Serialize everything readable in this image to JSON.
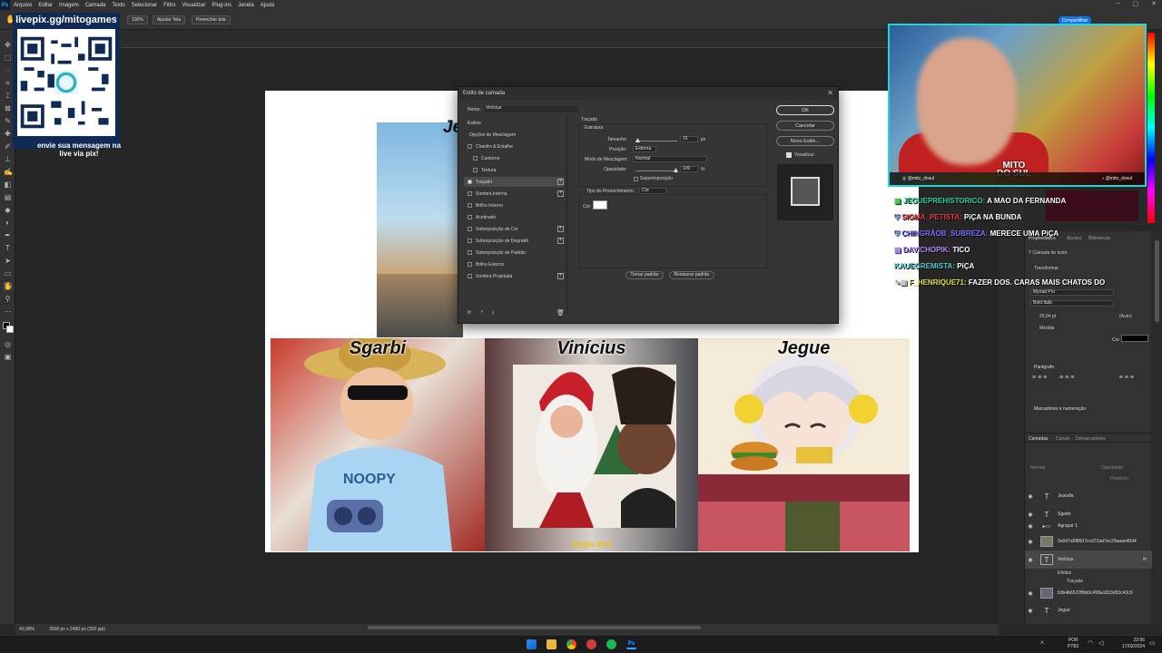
{
  "app": {
    "name": "Ps"
  },
  "menubar": {
    "items": [
      "Arquivo",
      "Editar",
      "Imagem",
      "Camada",
      "Texto",
      "Selecionar",
      "Filtro",
      "Visualizar",
      "Plug-ins",
      "Janela",
      "Ajuda"
    ]
  },
  "options": {
    "zoom_value": "100%",
    "fit_label": "Ajustar Tela",
    "fill_label": "Preencher tela",
    "share_label": "Compartilhar"
  },
  "document": {
    "top_name": "Je",
    "panels": [
      {
        "name": "Sgarbi"
      },
      {
        "name": "Vinícius",
        "caption": "Jingle Bell"
      },
      {
        "name": "Jegue"
      }
    ]
  },
  "dialog": {
    "title": "Estilo de camada",
    "name_label": "Nome:",
    "name_value": "Vinícius",
    "styles_label": "Estilos",
    "blend_options": "Opções de Mesclagem",
    "effects": [
      {
        "label": "Chanfro & Entalhe",
        "checked": false,
        "plus": false
      },
      {
        "label": "Contorno",
        "checked": false,
        "plus": false,
        "indent": true
      },
      {
        "label": "Textura",
        "checked": false,
        "plus": false,
        "indent": true
      },
      {
        "label": "Traçado",
        "checked": true,
        "plus": true
      },
      {
        "label": "Sombra Interna",
        "checked": false,
        "plus": true
      },
      {
        "label": "Brilho Interno",
        "checked": false,
        "plus": false
      },
      {
        "label": "Acetinado",
        "checked": false,
        "plus": false
      },
      {
        "label": "Sobreposição de Cor",
        "checked": false,
        "plus": true
      },
      {
        "label": "Sobreposição de Degradê",
        "checked": false,
        "plus": true
      },
      {
        "label": "Sobreposição de Padrão",
        "checked": false,
        "plus": false
      },
      {
        "label": "Brilho Externo",
        "checked": false,
        "plus": false
      },
      {
        "label": "Sombra Projetada",
        "checked": false,
        "plus": true
      }
    ],
    "section_title": "Traçado",
    "structure_label": "Estrutura",
    "size_label": "Tamanho:",
    "size_value": "16",
    "size_unit": "px",
    "position_label": "Posição:",
    "position_value": "Externa",
    "blend_label": "Modo de Mesclagem:",
    "blend_value": "Normal",
    "opacity_label": "Opacidade:",
    "opacity_value": "100",
    "opacity_unit": "%",
    "overprint_label": "Superimposição",
    "fill_type_label": "Tipo de Preenchimento:",
    "fill_type_value": "Cor",
    "color_label": "Cor:",
    "default_label": "Tornar padrão",
    "reset_label": "Restaurar padrão",
    "ok_label": "OK",
    "cancel_label": "Cancelar",
    "new_style_label": "Novo Estilo...",
    "preview_label": "Visualizar",
    "fx_label": "fx"
  },
  "webcam": {
    "instagram": "@mito_dosul",
    "tiktok": "@mito_dosul",
    "logo_line1": "MITO",
    "logo_line2": "DO SUL"
  },
  "chat": [
    {
      "user": "JEGUEPREHISTORICO:",
      "msg": "A MAO DA FERNANDA",
      "color": "#1fd4a0"
    },
    {
      "user": "SIGMA_PETISTA:",
      "msg": "PiÇA NA BUNDA",
      "color": "#e63b3b"
    },
    {
      "user": "CHINGRÁOB_SUBREZA:",
      "msg": "MERECE UMA PiÇA",
      "color": "#7a72ff"
    },
    {
      "user": "DAVICHOPIK:",
      "msg": "TICO",
      "color": "#b48cff"
    },
    {
      "user": "KAUEGREMISTA:",
      "msg": "PiÇA",
      "color": "#58c8c8"
    },
    {
      "user": "F_HENRIQUE71:",
      "msg": "FAZER DOS. CARAS MAIS CHATOS DO",
      "color": "#e8e04a"
    }
  ],
  "qr": {
    "title": "livepix.gg/mitogames",
    "text1": "envie sua mensagem na",
    "text2": "live via pix!"
  },
  "properties": {
    "tabs": [
      "Propriedades",
      "Ajustes",
      "Bibliotecas"
    ],
    "layer_type": "Camada de texto",
    "transform": "Transformar",
    "font": "Myriad Pro",
    "font_style": "Bold Italic",
    "size": "25,04 pt",
    "leading": "(Auto)",
    "tracking": "Medida",
    "color_label": "Cor",
    "paragraph": "Parágrafo",
    "guides": "Marcadores e numeração"
  },
  "layers": {
    "tabs": [
      "Camadas",
      "Canais",
      "Demarcadores"
    ],
    "mode": "Normal",
    "opacity_label": "Opacidade:",
    "fill_label": "Preench.:",
    "items": [
      {
        "kind": "T",
        "name": "Jeandla"
      },
      {
        "kind": "T",
        "name": "Sgarbi"
      },
      {
        "kind": "G",
        "name": "Agrupar 1"
      },
      {
        "kind": "I",
        "name": "0a9d7a5f8607ccd72ad7ac29aaae40d4"
      },
      {
        "kind": "T",
        "name": "Vinícius",
        "selected": true
      },
      {
        "kind": "I",
        "name": "b3b4b6522ffbb0c458a1833d50c43c9"
      },
      {
        "kind": "T",
        "name": "Jegue"
      }
    ],
    "effects_label": "Efeitos",
    "effect_item": "Traçado"
  },
  "status": {
    "zoom": "40,98%",
    "size": "3508 px x 2480 px (300 ppi)"
  },
  "taskbar": {
    "lang": "POR",
    "lang2": "PTB2",
    "time": "22:56",
    "date": "17/02/2024"
  }
}
